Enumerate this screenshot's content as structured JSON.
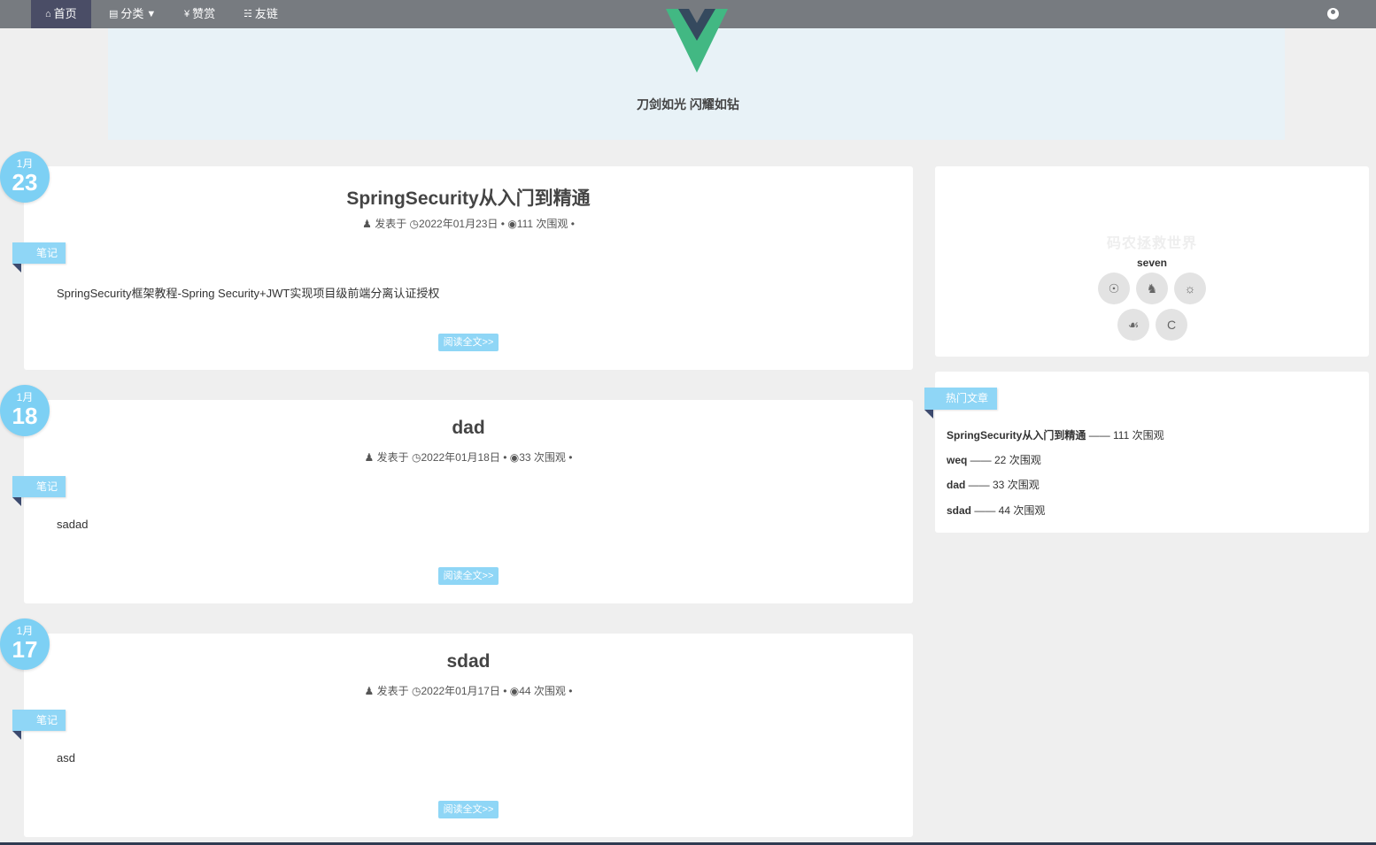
{
  "nav": {
    "home": "首页",
    "category": "分类",
    "reward": "赞赏",
    "links": "友链"
  },
  "banner": {
    "motto": "刀剑如光 闪耀如钻"
  },
  "posts": [
    {
      "month": "1月",
      "day": "23",
      "title": "SpringSecurity从入门到精通",
      "meta_posted": "发表于",
      "meta_date": "2022年01月23日",
      "meta_views": "111 次围观",
      "tag": "笔记",
      "summary": "SpringSecurity框架教程-Spring Security+JWT实现项目级前端分离认证授权",
      "read_more": "阅读全文>>"
    },
    {
      "month": "1月",
      "day": "18",
      "title": "dad",
      "meta_posted": "发表于",
      "meta_date": "2022年01月18日",
      "meta_views": "33 次围观",
      "tag": "笔记",
      "summary": "sadad",
      "read_more": "阅读全文>>"
    },
    {
      "month": "1月",
      "day": "17",
      "title": "sdad",
      "meta_posted": "发表于",
      "meta_date": "2022年01月17日",
      "meta_views": "44 次围观",
      "tag": "笔记",
      "summary": "asd",
      "read_more": "阅读全文>>"
    }
  ],
  "profile": {
    "site_name": "码农拯救世界",
    "name": "seven",
    "social": [
      "github-icon",
      "qq-icon",
      "weibo-icon",
      "wechat-icon",
      "csdn-icon"
    ],
    "csdn_letter": "C"
  },
  "hot": {
    "title": "热门文章",
    "items": [
      {
        "name": "SpringSecurity从入门到精通",
        "views": " —— 111 次围观"
      },
      {
        "name": "weq",
        "views": " —— 22 次围观"
      },
      {
        "name": "dad",
        "views": " —— 33 次围观"
      },
      {
        "name": "sdad",
        "views": " —— 44 次围观"
      }
    ]
  },
  "colors": {
    "nav_bg": "#777b80",
    "nav_active": "#4a4d66",
    "accent": "#8fd6f6",
    "date_circle": "#7dd0f4",
    "banner_bg": "#e8f2f7",
    "vue_green": "#42b883",
    "vue_dark": "#35495e"
  }
}
